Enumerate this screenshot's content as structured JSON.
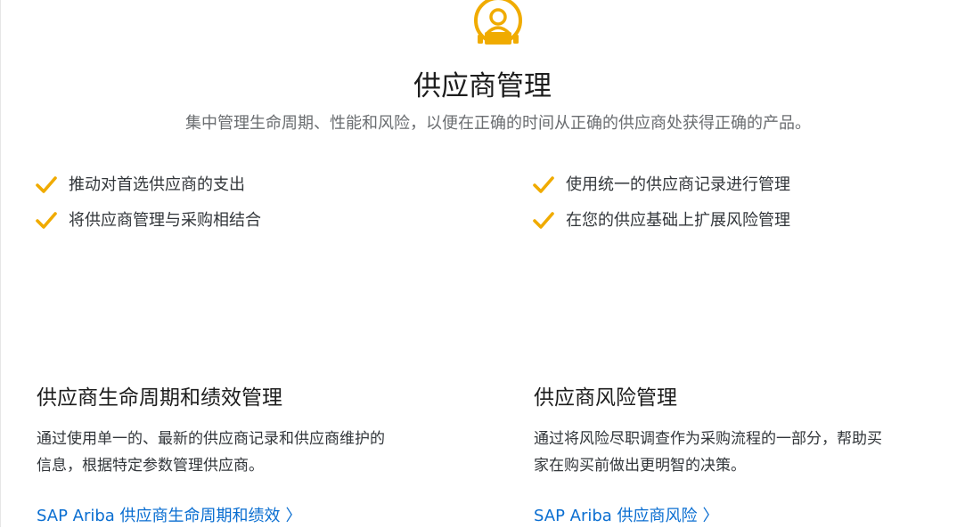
{
  "colors": {
    "accent": "#F0AB00",
    "link": "#0A6ED1",
    "title": "#1D1D1D",
    "body_text": "#32363A",
    "subtitle": "#6A6D70"
  },
  "hero": {
    "icon": "supplier-person-icon",
    "title": "供应商管理",
    "subtitle": "集中管理生命周期、性能和风险，以便在正确的时间从正确的供应商处获得正确的产品。"
  },
  "bullets": {
    "left": [
      {
        "icon": "check-icon",
        "text": "推动对首选供应商的支出"
      },
      {
        "icon": "check-icon",
        "text": "将供应商管理与采购相结合"
      }
    ],
    "right": [
      {
        "icon": "check-icon",
        "text": "使用统一的供应商记录进行管理"
      },
      {
        "icon": "check-icon",
        "text": "在您的供应基础上扩展风险管理"
      }
    ]
  },
  "features": [
    {
      "title": "供应商生命周期和绩效管理",
      "description_line1": "通过使用单一的、最新的供应商记录和供应商维护的",
      "description_line2": "信息，根据特定参数管理供应商。",
      "link_text": "SAP Ariba 供应商生命周期和绩效",
      "link_icon": "chevron-right-icon",
      "chevron": "〉"
    },
    {
      "title": "供应商风险管理",
      "description_line1": "通过将风险尽职调查作为采购流程的一部分，帮助买",
      "description_line2": "家在购买前做出更明智的决策。",
      "link_text": "SAP Ariba 供应商风险",
      "link_icon": "chevron-right-icon",
      "chevron": "〉"
    }
  ]
}
